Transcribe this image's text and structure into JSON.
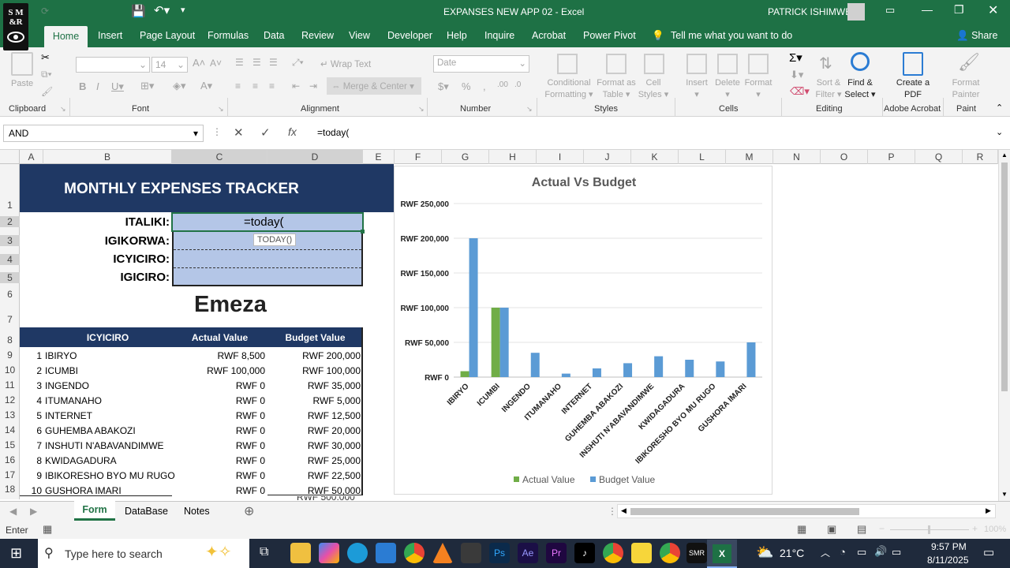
{
  "window": {
    "title": "EXPANSES NEW APP 02  -  Excel",
    "user": "PATRICK ISHIMWE"
  },
  "ribbon_tabs": [
    "Home",
    "Insert",
    "Page Layout",
    "Formulas",
    "Data",
    "Review",
    "View",
    "Developer",
    "Help",
    "Inquire",
    "Acrobat",
    "Power Pivot"
  ],
  "tell_me": "Tell me what you want to do",
  "share": "Share",
  "ribbon": {
    "paste": "Paste",
    "clipboard": "Clipboard",
    "font_size": "14",
    "font": "Font",
    "wrap": "Wrap Text",
    "merge": "Merge & Center",
    "alignment": "Alignment",
    "numfmt": "Date",
    "number": "Number",
    "cond": "Conditional Formatting",
    "fmt_table": "Format as Table",
    "cell_styles": "Cell Styles",
    "styles": "Styles",
    "insert": "Insert",
    "delete": "Delete",
    "format": "Format",
    "cells": "Cells",
    "sort": "Sort & Filter",
    "find": "Find & Select",
    "editing": "Editing",
    "create_pdf": "Create a PDF",
    "adobe": "Adobe Acrobat",
    "format_painter": "Format Painter",
    "paint": "Paint"
  },
  "formula_bar": {
    "name_box": "AND",
    "formula": "=today("
  },
  "columns": [
    "A",
    "B",
    "C",
    "D",
    "E",
    "F",
    "G",
    "H",
    "I",
    "J",
    "K",
    "L",
    "M",
    "N",
    "O",
    "P",
    "Q",
    "R"
  ],
  "rows": [
    "1",
    "2",
    "3",
    "4",
    "5",
    "6",
    "7",
    "8",
    "9",
    "10",
    "11",
    "12",
    "13",
    "14",
    "15",
    "16",
    "17",
    "18"
  ],
  "sheet": {
    "header": "MONTHLY EXPENSES TRACKER",
    "fields": [
      "ITALIKI:",
      "IGIKORWA:",
      "ICYICIRO:",
      "IGICIRO:"
    ],
    "editing": "=today(",
    "tooltip": "TODAY()",
    "button": "Emeza",
    "table_headers": [
      "ICYICIRO",
      "Actual Value",
      "Budget Value"
    ],
    "table_rows": [
      [
        "1",
        "IBIRYO",
        "RWF 8,500",
        "RWF 200,000"
      ],
      [
        "2",
        "ICUMBI",
        "RWF 100,000",
        "RWF 100,000"
      ],
      [
        "3",
        "INGENDO",
        "RWF 0",
        "RWF 35,000"
      ],
      [
        "4",
        "ITUMANAHO",
        "RWF 0",
        "RWF 5,000"
      ],
      [
        "5",
        "INTERNET",
        "RWF 0",
        "RWF 12,500"
      ],
      [
        "6",
        "GUHEMBA ABAKOZI",
        "RWF 0",
        "RWF 20,000"
      ],
      [
        "7",
        "INSHUTI N'ABAVANDIMWE",
        "RWF 0",
        "RWF 30,000"
      ],
      [
        "8",
        "KWIDAGADURA",
        "RWF 0",
        "RWF 25,000"
      ],
      [
        "9",
        "IBIKORESHO BYO MU RUGO",
        "RWF 0",
        "RWF 22,500"
      ],
      [
        "10",
        "GUSHORA IMARI",
        "RWF 0",
        "RWF 50,000"
      ]
    ]
  },
  "chart_data": {
    "type": "bar",
    "title": "Actual Vs Budget",
    "categories": [
      "IBIRYO",
      "ICUMBI",
      "INGENDO",
      "ITUMANAHO",
      "INTERNET",
      "GUHEMBA ABAKOZI",
      "INSHUTI N'ABAVANDIMWE",
      "KWIDAGADURA",
      "IBIKORESHO BYO MU RUGO",
      "GUSHORA IMARI"
    ],
    "series": [
      {
        "name": "Actual Value",
        "color": "#70ad47",
        "values": [
          8500,
          100000,
          0,
          0,
          0,
          0,
          0,
          0,
          0,
          0
        ]
      },
      {
        "name": "Budget Value",
        "color": "#5b9bd5",
        "values": [
          200000,
          100000,
          35000,
          5000,
          12500,
          20000,
          30000,
          25000,
          22500,
          50000
        ]
      }
    ],
    "yticks": [
      "RWF 0",
      "RWF 50,000",
      "RWF 100,000",
      "RWF 150,000",
      "RWF 200,000",
      "RWF 250,000"
    ],
    "ylim": [
      0,
      250000
    ],
    "legend": "bottom"
  },
  "sheet_tabs": [
    "Form",
    "DataBase",
    "Notes"
  ],
  "status": "Enter",
  "zoom": "100%",
  "taskbar": {
    "search": "Type here to search",
    "temp": "21°C",
    "time": "9:57 PM",
    "date": "8/11/2025"
  }
}
